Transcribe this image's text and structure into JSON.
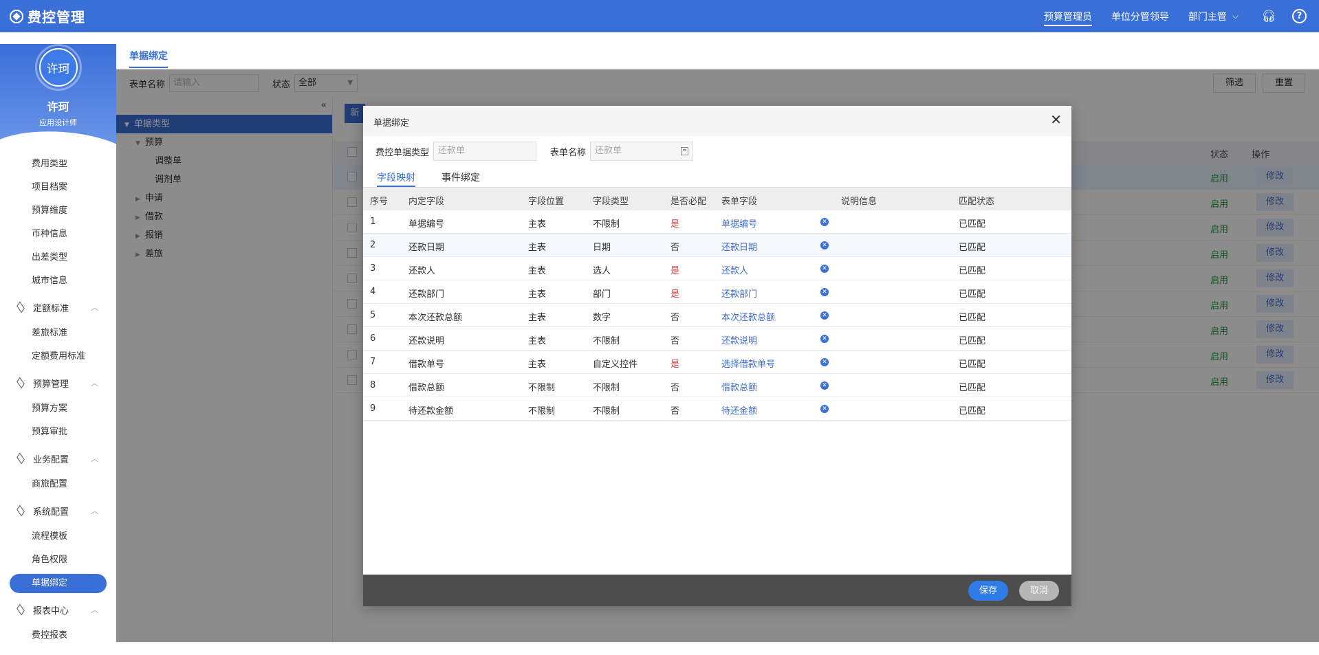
{
  "app": {
    "title": "费控管理"
  },
  "topbar": {
    "roles": [
      "预算管理员",
      "单位分管领导",
      "部门主管"
    ],
    "headset_icon": "headset-icon",
    "help_label": "?"
  },
  "user": {
    "name": "许珂",
    "avatar_text": "许珂",
    "role": "应用设计师"
  },
  "sidebar": {
    "items": [
      {
        "type": "item",
        "label": "费用类型"
      },
      {
        "type": "item",
        "label": "项目档案"
      },
      {
        "type": "item",
        "label": "预算维度"
      },
      {
        "type": "item",
        "label": "币种信息"
      },
      {
        "type": "item",
        "label": "出差类型"
      },
      {
        "type": "item",
        "label": "城市信息"
      },
      {
        "type": "group",
        "label": "定额标准"
      },
      {
        "type": "item",
        "label": "差旅标准"
      },
      {
        "type": "item",
        "label": "定额费用标准"
      },
      {
        "type": "group",
        "label": "预算管理"
      },
      {
        "type": "item",
        "label": "预算方案"
      },
      {
        "type": "item",
        "label": "预算审批"
      },
      {
        "type": "group",
        "label": "业务配置"
      },
      {
        "type": "item",
        "label": "商旅配置"
      },
      {
        "type": "group",
        "label": "系统配置"
      },
      {
        "type": "item",
        "label": "流程模板"
      },
      {
        "type": "item",
        "label": "角色权限"
      },
      {
        "type": "item",
        "label": "单据绑定",
        "active": true
      },
      {
        "type": "group",
        "label": "报表中心"
      },
      {
        "type": "item",
        "label": "费控报表"
      }
    ]
  },
  "page": {
    "tab": "单据绑定",
    "filter": {
      "form_name_label": "表单名称",
      "form_name_placeholder": "请输入",
      "status_label": "状态",
      "status_value": "全部",
      "filter_button": "筛选",
      "reset_button": "重置"
    },
    "tree": {
      "collapse_icon": "«",
      "root": "单据类型",
      "nodes": [
        {
          "label": "预算",
          "level": 1,
          "expanded": true
        },
        {
          "label": "调整单",
          "level": 2
        },
        {
          "label": "调剂单",
          "level": 2
        },
        {
          "label": "申请",
          "level": 1
        },
        {
          "label": "借款",
          "level": 1
        },
        {
          "label": "报销",
          "level": 1
        },
        {
          "label": "差旅",
          "level": 1
        }
      ]
    },
    "grid": {
      "toolbar_button": "新",
      "headers": {
        "status": "状态",
        "action": "操作"
      },
      "rows": [
        {
          "status": "启用",
          "action": "修改"
        },
        {
          "status": "启用",
          "action": "修改"
        },
        {
          "status": "启用",
          "action": "修改"
        },
        {
          "status": "启用",
          "action": "修改"
        },
        {
          "status": "启用",
          "action": "修改"
        },
        {
          "status": "启用",
          "action": "修改"
        },
        {
          "status": "启用",
          "action": "修改"
        },
        {
          "status": "启用",
          "action": "修改"
        },
        {
          "status": "启用",
          "action": "修改"
        }
      ]
    }
  },
  "modal": {
    "title": "单据绑定",
    "close_icon": "✕",
    "fields": {
      "doc_type_label": "费控单据类型",
      "doc_type_value": "还款单",
      "form_name_label": "表单名称",
      "form_name_value": "还款单"
    },
    "tabs": [
      "字段映射",
      "事件绑定"
    ],
    "columns": [
      "序号",
      "内定字段",
      "字段位置",
      "字段类型",
      "是否必配",
      "表单字段",
      "说明信息",
      "匹配状态"
    ],
    "rows": [
      {
        "no": "1",
        "field": "单据编号",
        "position": "主表",
        "type": "不限制",
        "required": "是",
        "form_field": "单据编号",
        "desc": "",
        "match": "已匹配"
      },
      {
        "no": "2",
        "field": "还款日期",
        "position": "主表",
        "type": "日期",
        "required": "否",
        "form_field": "还款日期",
        "desc": "",
        "match": "已匹配"
      },
      {
        "no": "3",
        "field": "还款人",
        "position": "主表",
        "type": "选人",
        "required": "是",
        "form_field": "还款人",
        "desc": "",
        "match": "已匹配"
      },
      {
        "no": "4",
        "field": "还款部门",
        "position": "主表",
        "type": "部门",
        "required": "是",
        "form_field": "还款部门",
        "desc": "",
        "match": "已匹配"
      },
      {
        "no": "5",
        "field": "本次还款总额",
        "position": "主表",
        "type": "数字",
        "required": "否",
        "form_field": "本次还款总额",
        "desc": "",
        "match": "已匹配"
      },
      {
        "no": "6",
        "field": "还款说明",
        "position": "主表",
        "type": "不限制",
        "required": "否",
        "form_field": "还款说明",
        "desc": "",
        "match": "已匹配"
      },
      {
        "no": "7",
        "field": "借款单号",
        "position": "主表",
        "type": "自定义控件",
        "required": "是",
        "form_field": "选择借款单号",
        "desc": "",
        "match": "已匹配"
      },
      {
        "no": "8",
        "field": "借款总额",
        "position": "不限制",
        "type": "不限制",
        "required": "否",
        "form_field": "借款总额",
        "desc": "",
        "match": "已匹配"
      },
      {
        "no": "9",
        "field": "待还款金额",
        "position": "不限制",
        "type": "不限制",
        "required": "否",
        "form_field": "待还金额",
        "desc": "",
        "match": "已匹配"
      }
    ],
    "save_button": "保存",
    "cancel_button": "取消"
  },
  "colors": {
    "primary": "#3b6fd8",
    "required": "#e43c3c",
    "enabled": "#1a9b3a",
    "footer": "#4d4d4d"
  }
}
